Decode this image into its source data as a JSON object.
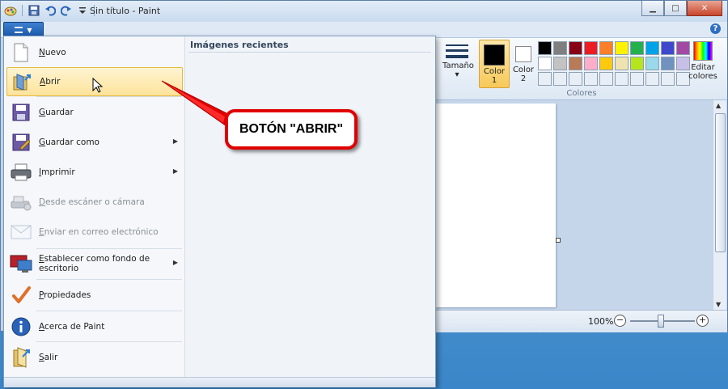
{
  "window": {
    "title": "Sin título - Paint",
    "buttons": {
      "minimize": "▁",
      "maximize": "□",
      "close": "✕"
    },
    "help": "?"
  },
  "ribbon": {
    "size_label": "Tamaño",
    "size_caret": "▾",
    "color1_label": "Color 1",
    "color2_label": "Color 2",
    "edit_colors_label": "Editar colores",
    "group_label": "Colores",
    "color1_value": "#000000",
    "color2_value": "#ffffff",
    "palette": [
      "#000000",
      "#7f7f7f",
      "#880015",
      "#ed1c24",
      "#ff7f27",
      "#fff200",
      "#22b14c",
      "#00a2e8",
      "#3f48cc",
      "#a349a4",
      "#ffffff",
      "#c3c3c3",
      "#b97a57",
      "#ffaec9",
      "#ffc90e",
      "#efe4b0",
      "#b5e61d",
      "#99d9ea",
      "#7092be",
      "#c8bfe7",
      "#e8eef6",
      "#e8eef6",
      "#e8eef6",
      "#e8eef6",
      "#e8eef6",
      "#e8eef6",
      "#e8eef6",
      "#e8eef6",
      "#e8eef6",
      "#e8eef6"
    ]
  },
  "status": {
    "zoom": "100%",
    "zoom_out": "−",
    "zoom_in": "+"
  },
  "menu": {
    "recent_title": "Imágenes recientes",
    "items": [
      {
        "label": "Nuevo",
        "icon": "new-document-icon",
        "arrow": "",
        "disabled": false
      },
      {
        "label": "Abrir",
        "icon": "open-folder-icon",
        "arrow": "",
        "disabled": false
      },
      {
        "label": "Guardar",
        "icon": "save-disk-icon",
        "arrow": "",
        "disabled": false
      },
      {
        "label": "Guardar como",
        "icon": "save-as-icon",
        "arrow": "▶",
        "disabled": false
      },
      {
        "label": "Imprimir",
        "icon": "printer-icon",
        "arrow": "▶",
        "disabled": false
      },
      {
        "label": "Desde escáner o cámara",
        "icon": "scanner-icon",
        "arrow": "",
        "disabled": true
      },
      {
        "label": "Enviar en correo electrónico",
        "icon": "email-icon",
        "arrow": "",
        "disabled": true
      },
      {
        "label": "Establecer como fondo de escritorio",
        "icon": "desktop-background-icon",
        "arrow": "▶",
        "disabled": false
      },
      {
        "label": "Propiedades",
        "icon": "checkmark-icon",
        "arrow": "",
        "disabled": false
      },
      {
        "label": "Acerca de Paint",
        "icon": "info-icon",
        "arrow": "",
        "disabled": false
      },
      {
        "label": "Salir",
        "icon": "exit-icon",
        "arrow": "",
        "disabled": false
      }
    ]
  },
  "callout": {
    "text": "BOTÓN \"ABRIR\"",
    "color": "#e00000"
  }
}
